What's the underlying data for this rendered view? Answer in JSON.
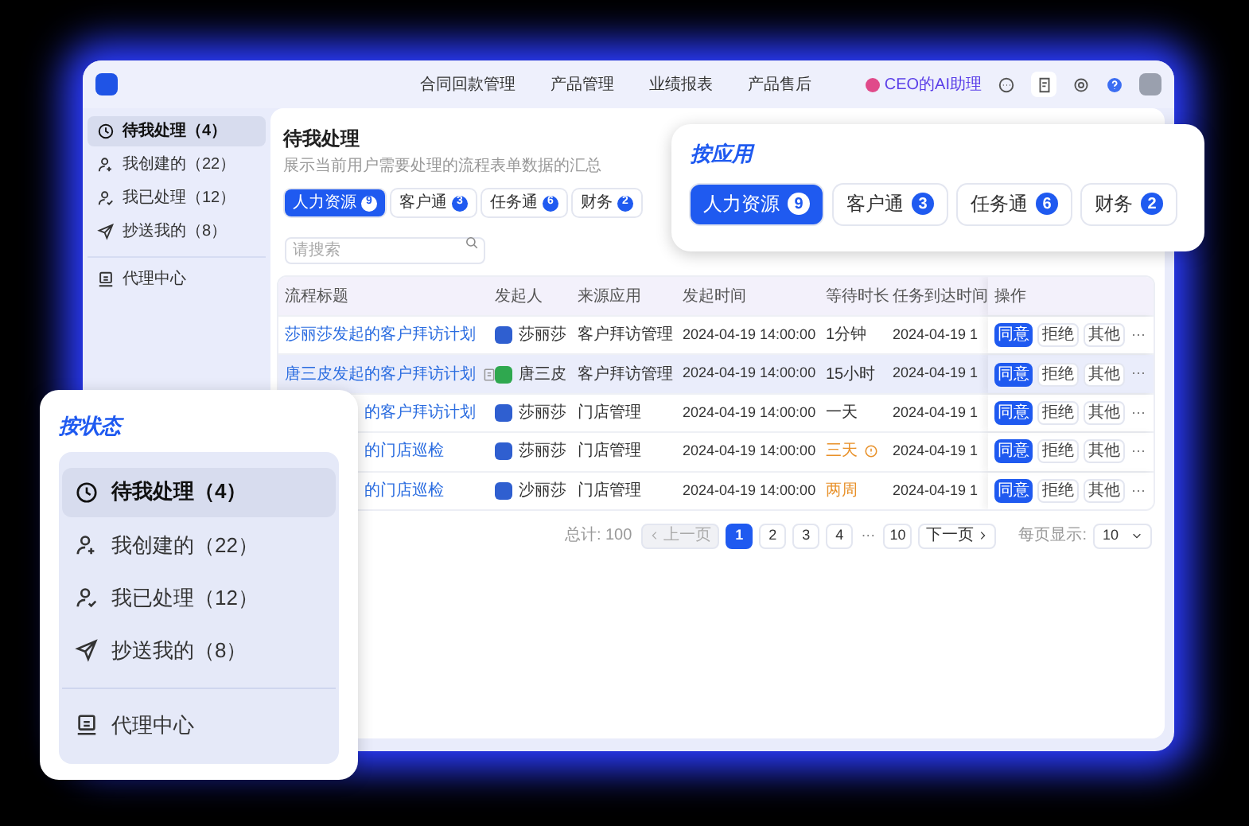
{
  "top_nav": {
    "items": [
      "合同回款管理",
      "产品管理",
      "业绩报表",
      "产品售后"
    ],
    "assistant": "CEO的AI助理"
  },
  "sidebar": {
    "items": [
      {
        "label": "待我处理（4）",
        "kind": "clock",
        "selected": true,
        "divider_before": false
      },
      {
        "label": "我创建的（22）",
        "kind": "user-plus",
        "selected": false,
        "divider_before": false
      },
      {
        "label": "我已处理（12）",
        "kind": "user-check",
        "selected": false,
        "divider_before": false
      },
      {
        "label": "抄送我的（8）",
        "kind": "send",
        "selected": false,
        "divider_before": false
      },
      {
        "label": "代理中心",
        "kind": "agent",
        "selected": false,
        "divider_before": true
      }
    ]
  },
  "page": {
    "title": "待我处理",
    "subtitle": "展示当前用户需要处理的流程表单数据的汇总"
  },
  "app_tabs": [
    {
      "label": "人力资源",
      "count": "9",
      "selected": true
    },
    {
      "label": "客户通",
      "count": "3",
      "selected": false
    },
    {
      "label": "任务通",
      "count": "6",
      "selected": false
    },
    {
      "label": "财务",
      "count": "2",
      "selected": false
    }
  ],
  "search": {
    "placeholder": "请搜索"
  },
  "table": {
    "columns": [
      "流程标题",
      "发起人",
      "来源应用",
      "发起时间",
      "等待时长",
      "任务到达时间",
      "操作"
    ],
    "rows": [
      {
        "title": "莎丽莎发起的客户拜访计划",
        "partly_hidden": false,
        "has_note": false,
        "selected": false,
        "initiator": "莎丽莎",
        "color": "#2f5fd0",
        "source": "客户拜访管理",
        "start": "2024-04-19 14:00:00",
        "wait": "1分钟",
        "wait_overdue": false,
        "wait_alert": false,
        "arrival": "2024-04-19 1",
        "actions": [
          "同意",
          "拒绝",
          "其他",
          "⋯"
        ]
      },
      {
        "title": "唐三皮发起的客户拜访计划",
        "partly_hidden": false,
        "has_note": true,
        "selected": true,
        "initiator": "唐三皮",
        "color": "#2fa84f",
        "source": "客户拜访管理",
        "start": "2024-04-19 14:00:00",
        "wait": "15小时",
        "wait_overdue": false,
        "wait_alert": false,
        "arrival": "2024-04-19 1",
        "actions": [
          "同意",
          "拒绝",
          "其他",
          "⋯"
        ]
      },
      {
        "title": "的客户拜访计划",
        "partly_hidden": true,
        "has_note": false,
        "selected": false,
        "initiator": "莎丽莎",
        "color": "#2f5fd0",
        "source": "门店管理",
        "start": "2024-04-19 14:00:00",
        "wait": "一天",
        "wait_overdue": false,
        "wait_alert": false,
        "arrival": "2024-04-19 1",
        "actions": [
          "同意",
          "拒绝",
          "其他",
          "⋯"
        ]
      },
      {
        "title": "的门店巡检",
        "partly_hidden": true,
        "has_note": false,
        "selected": false,
        "initiator": "莎丽莎",
        "color": "#2f5fd0",
        "source": "门店管理",
        "start": "2024-04-19 14:00:00",
        "wait": "三天",
        "wait_overdue": true,
        "wait_alert": true,
        "arrival": "2024-04-19 1",
        "actions": [
          "同意",
          "拒绝",
          "其他",
          "⋯"
        ]
      },
      {
        "title": "的门店巡检",
        "partly_hidden": true,
        "has_note": false,
        "selected": false,
        "initiator": "沙丽莎",
        "color": "#2f5fd0",
        "source": "门店管理",
        "start": "2024-04-19 14:00:00",
        "wait": "两周",
        "wait_overdue": true,
        "wait_alert": false,
        "arrival": "2024-04-19 1",
        "actions": [
          "同意",
          "拒绝",
          "其他",
          "⋯"
        ]
      }
    ]
  },
  "pagination": {
    "total": "总计: 100",
    "prev": "上一页",
    "prev_disabled": true,
    "pages": [
      {
        "label": "1",
        "kind": "page",
        "selected": true
      },
      {
        "label": "2",
        "kind": "page",
        "selected": false
      },
      {
        "label": "3",
        "kind": "page",
        "selected": false
      },
      {
        "label": "4",
        "kind": "page",
        "selected": false
      },
      {
        "label": "···",
        "kind": "ellipsis",
        "selected": false
      },
      {
        "label": "10",
        "kind": "page",
        "selected": false
      }
    ],
    "next": "下一页",
    "page_size_label": "每页显示:",
    "page_size": "10"
  },
  "app_callout": {
    "title": "按应用",
    "tabs": [
      {
        "label": "人力资源",
        "count": "9",
        "selected": true
      },
      {
        "label": "客户通",
        "count": "3",
        "selected": false
      },
      {
        "label": "任务通",
        "count": "6",
        "selected": false
      },
      {
        "label": "财务",
        "count": "2",
        "selected": false
      }
    ]
  },
  "status_callout": {
    "title": "按状态",
    "items": [
      {
        "label": "待我处理（4）",
        "kind": "clock",
        "selected": true,
        "divider_before": false
      },
      {
        "label": "我创建的（22）",
        "kind": "user-plus",
        "selected": false,
        "divider_before": false
      },
      {
        "label": "我已处理（12）",
        "kind": "user-check",
        "selected": false,
        "divider_before": false
      },
      {
        "label": "抄送我的（8）",
        "kind": "send",
        "selected": false,
        "divider_before": false
      },
      {
        "label": "代理中心",
        "kind": "agent",
        "selected": false,
        "divider_before": true
      }
    ]
  }
}
